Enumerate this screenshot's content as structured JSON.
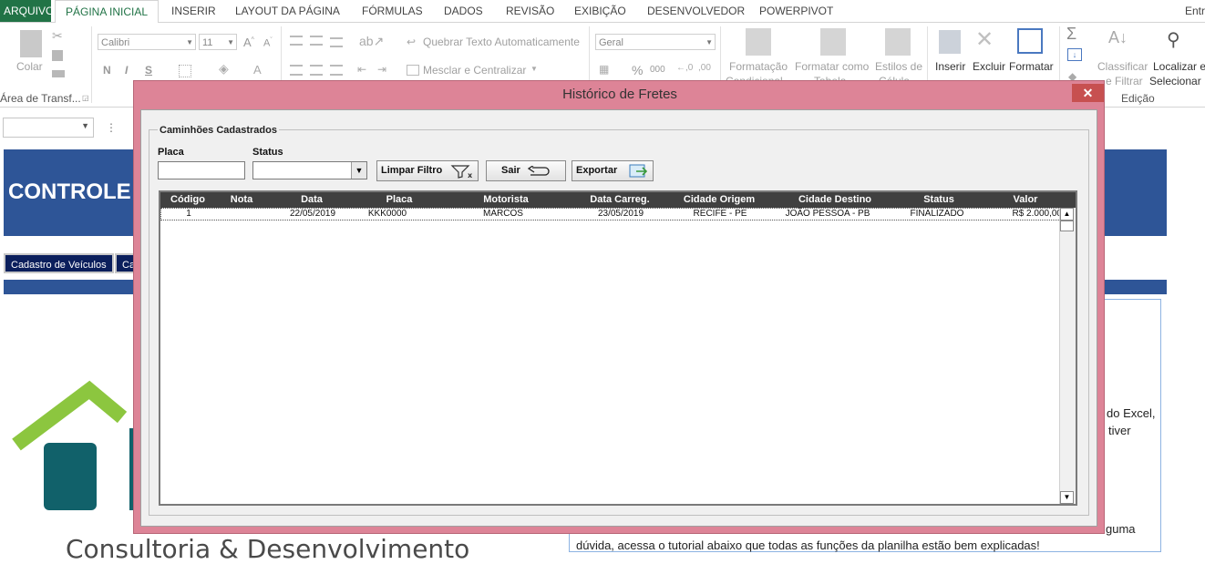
{
  "ribbon_tabs": {
    "file": "ARQUIVO",
    "home": "PÁGINA INICIAL",
    "insert": "INSERIR",
    "layout": "LAYOUT DA PÁGINA",
    "formulas": "FÓRMULAS",
    "data": "DADOS",
    "review": "REVISÃO",
    "view": "EXIBIÇÃO",
    "developer": "DESENVOLVEDOR",
    "powerpivot": "POWERPIVOT",
    "signin": "Entr"
  },
  "ribbon": {
    "paste_label": "Colar",
    "clipboard_group": "Área de Transf...",
    "font_name": "Calibri",
    "font_size": "11",
    "bold": "N",
    "italic": "I",
    "underline": "S",
    "wrap_text": "Quebrar Texto Automaticamente",
    "merge_center": "Mesclar e Centralizar",
    "number_format": "Geral",
    "percent": "%",
    "thousands": "000",
    "conditional_format": "Formatação",
    "conditional_format_2": "Condicional",
    "format_table": "Formatar como",
    "format_table_2": "Tabela",
    "cell_styles": "Estilos de",
    "cell_styles_2": "Célula",
    "insert_cells": "Inserir",
    "delete_cells": "Excluir",
    "format_cells": "Formatar",
    "sort_filter": "Classificar",
    "sort_filter_2": "e Filtrar",
    "find_select": "Localizar e",
    "find_select_2": "Selecionar",
    "editing_group": "Edição"
  },
  "sheet": {
    "banner_title": "CONTROLE D",
    "btn_vehicles": "Cadastro de Veículos",
    "btn_other": "Ca",
    "text_right_1": "do Excel,",
    "text_right_2": "tiver",
    "text_right_3": "guma",
    "text_bottom": "dúvida, acessa o tutorial abaixo que todas as funções da planilha estão bem explicadas!",
    "logo_text": "Consultoria & Desenvolvimento"
  },
  "dialog": {
    "title": "Histórico de Fretes",
    "close": "✕",
    "group_title": "Caminhões Cadastrados",
    "placa_label": "Placa",
    "status_label": "Status",
    "placa_value": "",
    "status_value": "",
    "btn_clear": "Limpar Filtro",
    "btn_exit": "Sair",
    "btn_export": "Exportar",
    "columns": [
      "Código",
      "Nota",
      "Data",
      "Placa",
      "Motorista",
      "Data Carreg.",
      "Cidade Origem",
      "Cidade Destino",
      "Status",
      "Valor"
    ],
    "rows": [
      {
        "codigo": "1",
        "nota": "",
        "data": "22/05/2019",
        "placa": "KKK0000",
        "motorista": "MARCOS",
        "data_carreg": "23/05/2019",
        "cidade_origem": "RECIFE - PE",
        "cidade_destino": "JOÃO PESSOA - PB",
        "status": "FINALIZADO",
        "valor": "R$ 2.000,00"
      }
    ]
  },
  "colors": {
    "excel_green": "#217346",
    "dialog_frame": "#dd8497",
    "banner_blue": "#2e5597",
    "header_dark": "#404040",
    "close_red": "#c75050"
  }
}
